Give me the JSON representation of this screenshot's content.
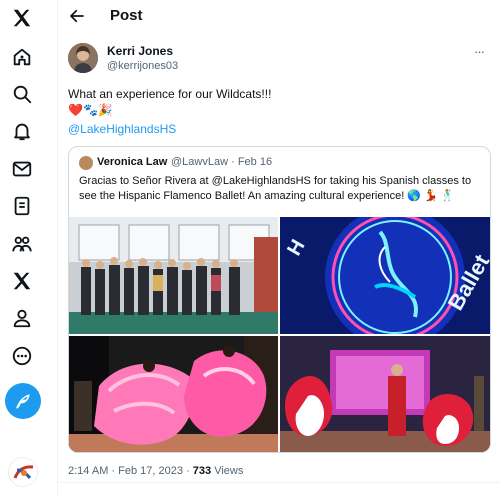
{
  "header": {
    "title": "Post"
  },
  "nav": {
    "items": [
      "x-logo",
      "home",
      "explore",
      "notifications",
      "messages",
      "lists",
      "communities",
      "premium",
      "profile",
      "more"
    ]
  },
  "post": {
    "author_name": "Kerri Jones",
    "author_handle": "@kerrijones03",
    "text": "What an experience for our Wildcats!!!",
    "emojis": "❤️🐾🎉",
    "mention": "@LakeHighlandsHS",
    "time": "2:14 AM",
    "date": "Feb 17, 2023",
    "views_count": "733",
    "views_label": "Views",
    "more_label": "···"
  },
  "quote": {
    "author_name": "Veronica Law",
    "author_handle": "@LawvLaw",
    "date": "Feb 16",
    "text": "Gracias to Señor Rivera at @LakeHighlandsHS for taking his Spanish classes to see the Hispanic Flamenco Ballet! An amazing cultural experience! 🌎 💃 🕺"
  },
  "colors": {
    "accent": "#1d9bf0",
    "text": "#0f1419",
    "secondary": "#536471",
    "border": "#cfd9de"
  }
}
